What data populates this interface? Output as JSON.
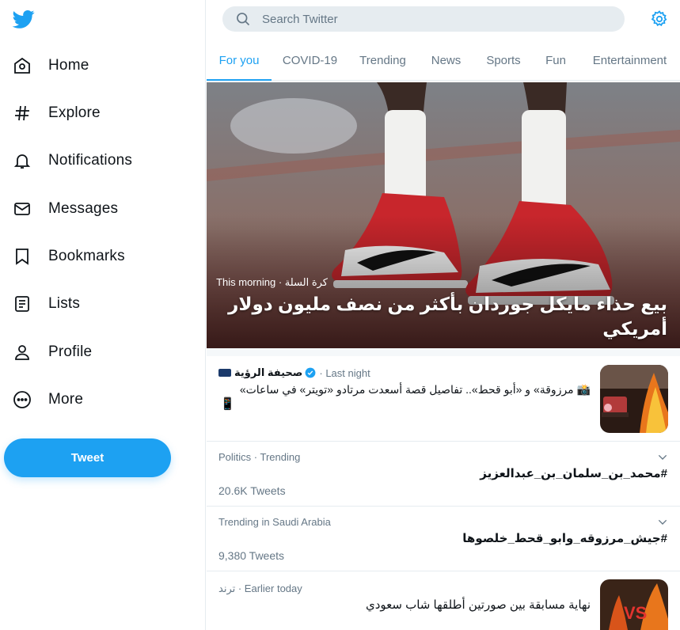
{
  "sidebar": {
    "logo": "twitter-bird-icon",
    "items": [
      {
        "label": "Home",
        "icon": "home-icon"
      },
      {
        "label": "Explore",
        "icon": "hashtag-icon"
      },
      {
        "label": "Notifications",
        "icon": "bell-icon"
      },
      {
        "label": "Messages",
        "icon": "envelope-icon"
      },
      {
        "label": "Bookmarks",
        "icon": "bookmark-icon"
      },
      {
        "label": "Lists",
        "icon": "list-icon"
      },
      {
        "label": "Profile",
        "icon": "person-icon"
      },
      {
        "label": "More",
        "icon": "more-circle-icon"
      }
    ],
    "tweet_label": "Tweet"
  },
  "search": {
    "placeholder": "Search Twitter"
  },
  "tabs": [
    {
      "label": "For you",
      "active": true
    },
    {
      "label": "COVID-19"
    },
    {
      "label": "Trending"
    },
    {
      "label": "News"
    },
    {
      "label": "Sports"
    },
    {
      "label": "Fun"
    },
    {
      "label": "Entertainment"
    }
  ],
  "hero": {
    "meta": "كرة السلة · This morning",
    "title": "بيع حذاء مايكل جوردان بأكثر من نصف مليون دولار أمريكي"
  },
  "news": {
    "source": "صحيفة الرؤية",
    "time": "· Last night",
    "headline": "📸 مرزوقة» و «أبو قحط».. تفاصيل قصة أسعدت مرتادو «تويتر» في ساعات»",
    "extra": "📱"
  },
  "trends": [
    {
      "context": "Politics · Trending",
      "name": "#محمد_بن_سلمان_بن_عبدالعزيز",
      "count": "20.6K Tweets"
    },
    {
      "context": "Trending in Saudi Arabia",
      "name": "#جيش_مرزوقه_وابو_قحط_خلصوها",
      "count": "9,380 Tweets"
    }
  ],
  "last": {
    "context": "ترند · Earlier today",
    "name": "نهاية مسابقة بين صورتين أطلقها شاب سعودي"
  },
  "colors": {
    "accent": "#1da1f2",
    "text": "#0f1419",
    "muted": "#657786",
    "border": "#e6ecf0"
  }
}
